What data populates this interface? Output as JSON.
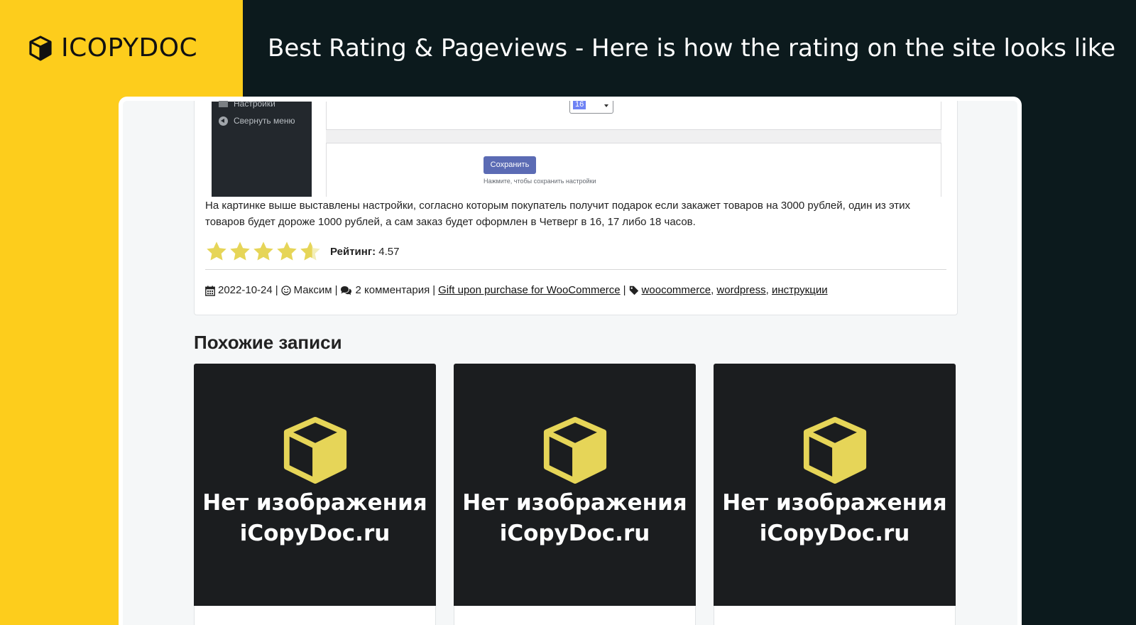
{
  "colors": {
    "brand_yellow": "#fdcd1c",
    "dark_bg": "#0c1a1d",
    "star_fill": "#e6d558",
    "save_button": "#5b6bb4",
    "thumb_bg": "#1b1d1f"
  },
  "brand": {
    "logo_icon": "cube-icon",
    "name": "ICOPYDOC"
  },
  "headline": "Best Rating & Pageviews - Here is how the rating on the site looks like",
  "admin_screenshot": {
    "menu_settings": "Настройки",
    "menu_collapse": "Свернуть меню",
    "select_value": "16",
    "save_button": "Сохранить",
    "save_hint": "Нажмите, чтобы сохранить настройки"
  },
  "post": {
    "body_text": "На картинке выше выставлены настройки, согласно которым покупатель получит подарок если закажет товаров на 3000 рублей, один из этих товаров будет дороже 1000 рублей, а сам заказ будет оформлен в Четверг в 16, 17 либо 18 часов.",
    "rating": {
      "label": "Рейтинг:",
      "value": "4.57",
      "stars_max": 5,
      "stars_value": 4.57
    },
    "meta": {
      "date": "2022-10-24",
      "author": "Максим",
      "comments": "2 комментария",
      "category": "Gift upon purchase for WooCommerce",
      "tags": [
        "woocommerce",
        "wordpress",
        "инструкции"
      ],
      "separator": "|"
    }
  },
  "similar": {
    "title": "Похожие записи",
    "items": [
      {
        "caption_line1": "Нет изображения",
        "caption_line2": "iCopyDoc.ru"
      },
      {
        "caption_line1": "Нет изображения",
        "caption_line2": "iCopyDoc.ru"
      },
      {
        "caption_line1": "Нет изображения",
        "caption_line2": "iCopyDoc.ru"
      }
    ]
  }
}
